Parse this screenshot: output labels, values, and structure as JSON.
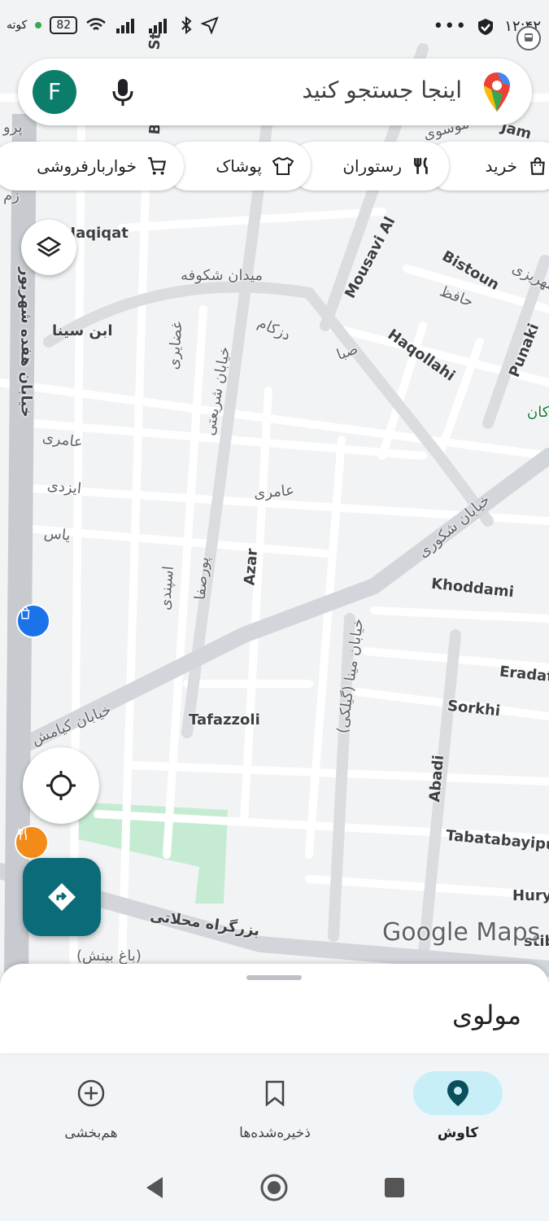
{
  "status_bar": {
    "carrier_text": "کوته",
    "battery": "82",
    "time": "۱۲:۴۲",
    "icons": [
      "wifi-icon",
      "signal-icon",
      "signal-icon",
      "bluetooth-icon",
      "location-arrow-icon",
      "more-dots-icon",
      "shield-check-icon",
      "bus-icon"
    ]
  },
  "search": {
    "avatar_letter": "F",
    "placeholder": "اینجا جستجو کنید"
  },
  "chips": [
    {
      "label": "خرید",
      "icon": "shopping-bag-icon"
    },
    {
      "label": "رستوران",
      "icon": "fork-knife-icon"
    },
    {
      "label": "پوشاک",
      "icon": "shirt-icon"
    },
    {
      "label": "خواربارفروشی",
      "icon": "cart-icon"
    }
  ],
  "map": {
    "labels": {
      "haqiqat": "Haqiqat",
      "meydan_shekufeh": "میدان شکوفه",
      "ebn_sina": "ابن سینا",
      "hefdah_shahrivar": "خیابان هفده شهریور",
      "mousavi": "Mousavi Al",
      "bistoun": "Bistoun",
      "hafez": "حافظ",
      "haqollahi": "Haqollahi",
      "punaki": "Punaki",
      "saba": "صبا",
      "dezkam": "دزکام",
      "ghazayeri": "غضایری",
      "shariati": "خیابان شریعتی",
      "ameri_1": "عامری",
      "ameri_2": "عامری",
      "izadi": "ایزدی",
      "yas": "یاس",
      "shokouri": "خیابان شکوری",
      "khoddami": "Khoddami",
      "azar": "Azar",
      "purseda": "پورصفا",
      "espandi": "اسپندی",
      "minaa": "خیابان مینا (گیلکی)",
      "eradat": "Eradat",
      "sorkhi": "Sorkhi",
      "tafazzoli": "Tafazzoli",
      "kiamesh": "خیابان کیامش",
      "abadi": "Abadi",
      "tabatabayi": "Tabatabayipu",
      "hury": "Hury",
      "mahallati": "بزرگراه محلاتی",
      "st": "St",
      "b": "B",
      "parv": "پرو",
      "zam": "زم",
      "mousavi_top": "موسوی",
      "jam": "Jam",
      "mehrizi": "مهریزی",
      "kan": "کان",
      "stib": "stib",
      "bahar": "(باغ بینش)"
    }
  },
  "watermark": "Google Maps",
  "sheet": {
    "title": "مولوی"
  },
  "bottom_nav": [
    {
      "label": "کاوش",
      "icon": "location-pin-icon",
      "active": true
    },
    {
      "label": "ذخیره‌شده‌ها",
      "icon": "bookmark-icon",
      "active": false
    },
    {
      "label": "هم‌بخشی",
      "icon": "add-circle-icon",
      "active": false
    }
  ],
  "colors": {
    "accent": "#0b6b78",
    "avatar": "#0b7d6a",
    "active_nav_bg": "#c8eef7",
    "park": "#c5ecd2"
  }
}
